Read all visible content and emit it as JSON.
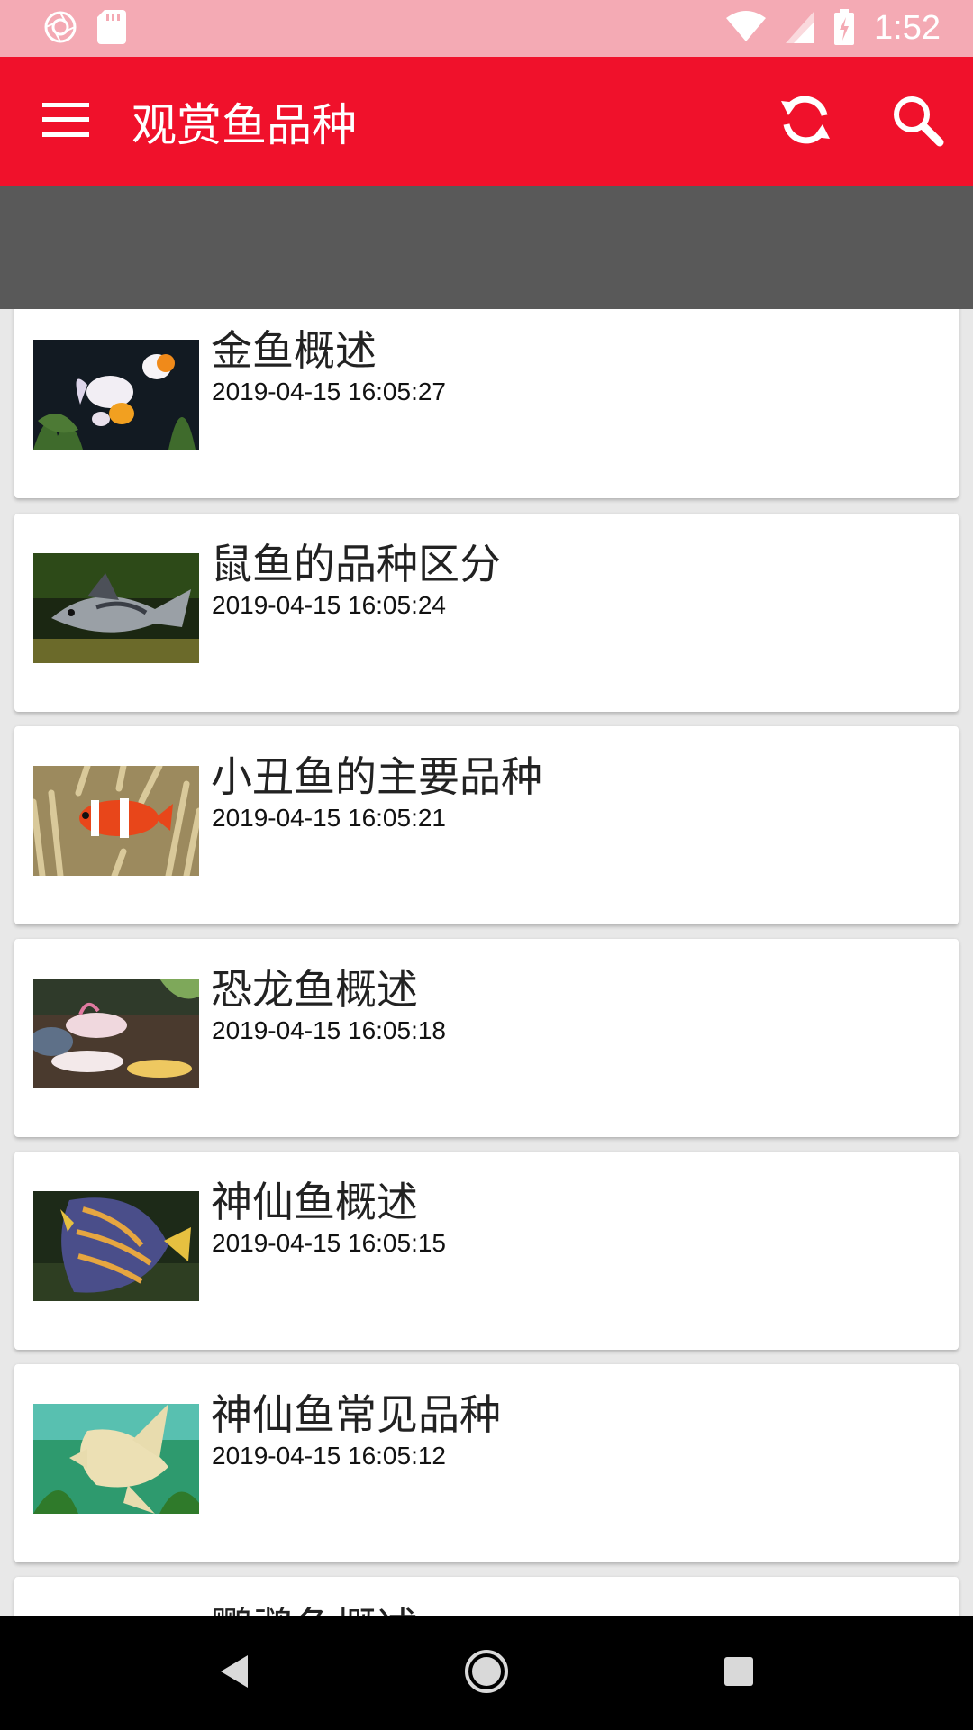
{
  "status_bar": {
    "time": "1:52",
    "icons": [
      "aperture-icon",
      "sd-card-icon",
      "wifi-icon",
      "signal-icon",
      "battery-charging-icon"
    ]
  },
  "app_bar": {
    "title": "观赏鱼品种",
    "icons": [
      "menu-icon",
      "refresh-icon",
      "search-icon"
    ],
    "background": "#f0112b"
  },
  "banner": {
    "color": "#595959"
  },
  "articles": [
    {
      "title": "金鱼概述",
      "date": "2019-04-15 16:05:27"
    },
    {
      "title": "鼠鱼的品种区分",
      "date": "2019-04-15 16:05:24"
    },
    {
      "title": "小丑鱼的主要品种",
      "date": "2019-04-15 16:05:21"
    },
    {
      "title": "恐龙鱼概述",
      "date": "2019-04-15 16:05:18"
    },
    {
      "title": "神仙鱼概述",
      "date": "2019-04-15 16:05:15"
    },
    {
      "title": "神仙鱼常见品种",
      "date": "2019-04-15 16:05:12"
    },
    {
      "title": "鹦鹉鱼概述",
      "date": ""
    }
  ],
  "nav_bar": {
    "icons": [
      "back-icon",
      "home-icon",
      "recents-icon"
    ]
  }
}
